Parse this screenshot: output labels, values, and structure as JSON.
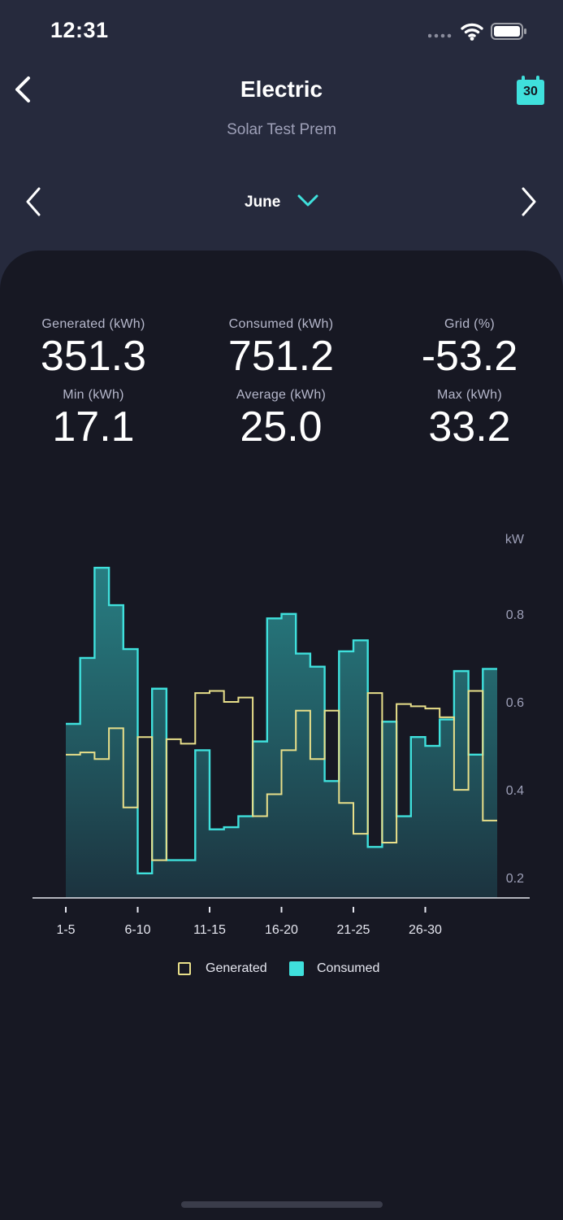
{
  "status_bar": {
    "time": "12:31",
    "icons": [
      "signal-dots-icon",
      "wifi-icon",
      "battery-icon"
    ]
  },
  "header": {
    "title": "Electric",
    "subtitle": "Solar Test Prem",
    "back_icon": "chevron-left-icon",
    "calendar_icon": "calendar-icon",
    "calendar_day": "30"
  },
  "period": {
    "label": "June",
    "prev_icon": "chevron-left-icon",
    "next_icon": "chevron-right-icon",
    "dropdown_icon": "chevron-down-icon"
  },
  "stats": [
    {
      "label": "Generated (kWh)",
      "value": "351.3"
    },
    {
      "label": "Consumed (kWh)",
      "value": "751.2"
    },
    {
      "label": "Grid (%)",
      "value": "-53.2"
    },
    {
      "label": "Min (kWh)",
      "value": "17.1"
    },
    {
      "label": "Average (kWh)",
      "value": "25.0"
    },
    {
      "label": "Max (kWh)",
      "value": "33.2"
    }
  ],
  "colors": {
    "accent": "#3fe0dc",
    "generated": "#e8df8a",
    "consumed": "#3fe0dc",
    "header_bg": "#262a3d",
    "panel_bg": "#171823"
  },
  "chart_data": {
    "type": "area",
    "ylabel": "kW",
    "ylim": [
      0.18,
      0.92
    ],
    "y_ticks": [
      0.2,
      0.4,
      0.6,
      0.8
    ],
    "y_tick_labels": [
      "0.2",
      "0.4",
      "0.6",
      "0.8"
    ],
    "x_tick_labels": [
      "1-5",
      "6-10",
      "11-15",
      "16-20",
      "21-25",
      "26-30"
    ],
    "x_tick_days": [
      1,
      6,
      11,
      16,
      21,
      26
    ],
    "step_days": [
      1,
      2,
      3,
      4,
      5,
      6,
      7,
      8,
      9,
      10,
      11,
      12,
      13,
      14,
      15,
      16,
      17,
      18,
      19,
      20,
      21,
      22,
      23,
      24,
      25,
      26,
      27,
      28,
      29,
      30
    ],
    "grid": false,
    "legend_position": "bottom-center",
    "series": [
      {
        "name": "Generated",
        "style": "outline",
        "values": [
          0.48,
          0.485,
          0.47,
          0.54,
          0.36,
          0.52,
          0.24,
          0.515,
          0.505,
          0.62,
          0.625,
          0.6,
          0.61,
          0.34,
          0.39,
          0.49,
          0.58,
          0.47,
          0.58,
          0.37,
          0.3,
          0.62,
          0.28,
          0.595,
          0.59,
          0.585,
          0.565,
          0.4,
          0.625,
          0.33
        ]
      },
      {
        "name": "Consumed",
        "style": "filled",
        "values": [
          0.55,
          0.7,
          0.905,
          0.82,
          0.72,
          0.21,
          0.63,
          0.24,
          0.24,
          0.49,
          0.31,
          0.315,
          0.34,
          0.51,
          0.79,
          0.8,
          0.71,
          0.68,
          0.42,
          0.715,
          0.74,
          0.27,
          0.555,
          0.34,
          0.52,
          0.5,
          0.56,
          0.67,
          0.48,
          0.675
        ]
      }
    ]
  },
  "legend": {
    "items": [
      {
        "label": "Generated",
        "style": "outline"
      },
      {
        "label": "Consumed",
        "style": "filled"
      }
    ]
  }
}
